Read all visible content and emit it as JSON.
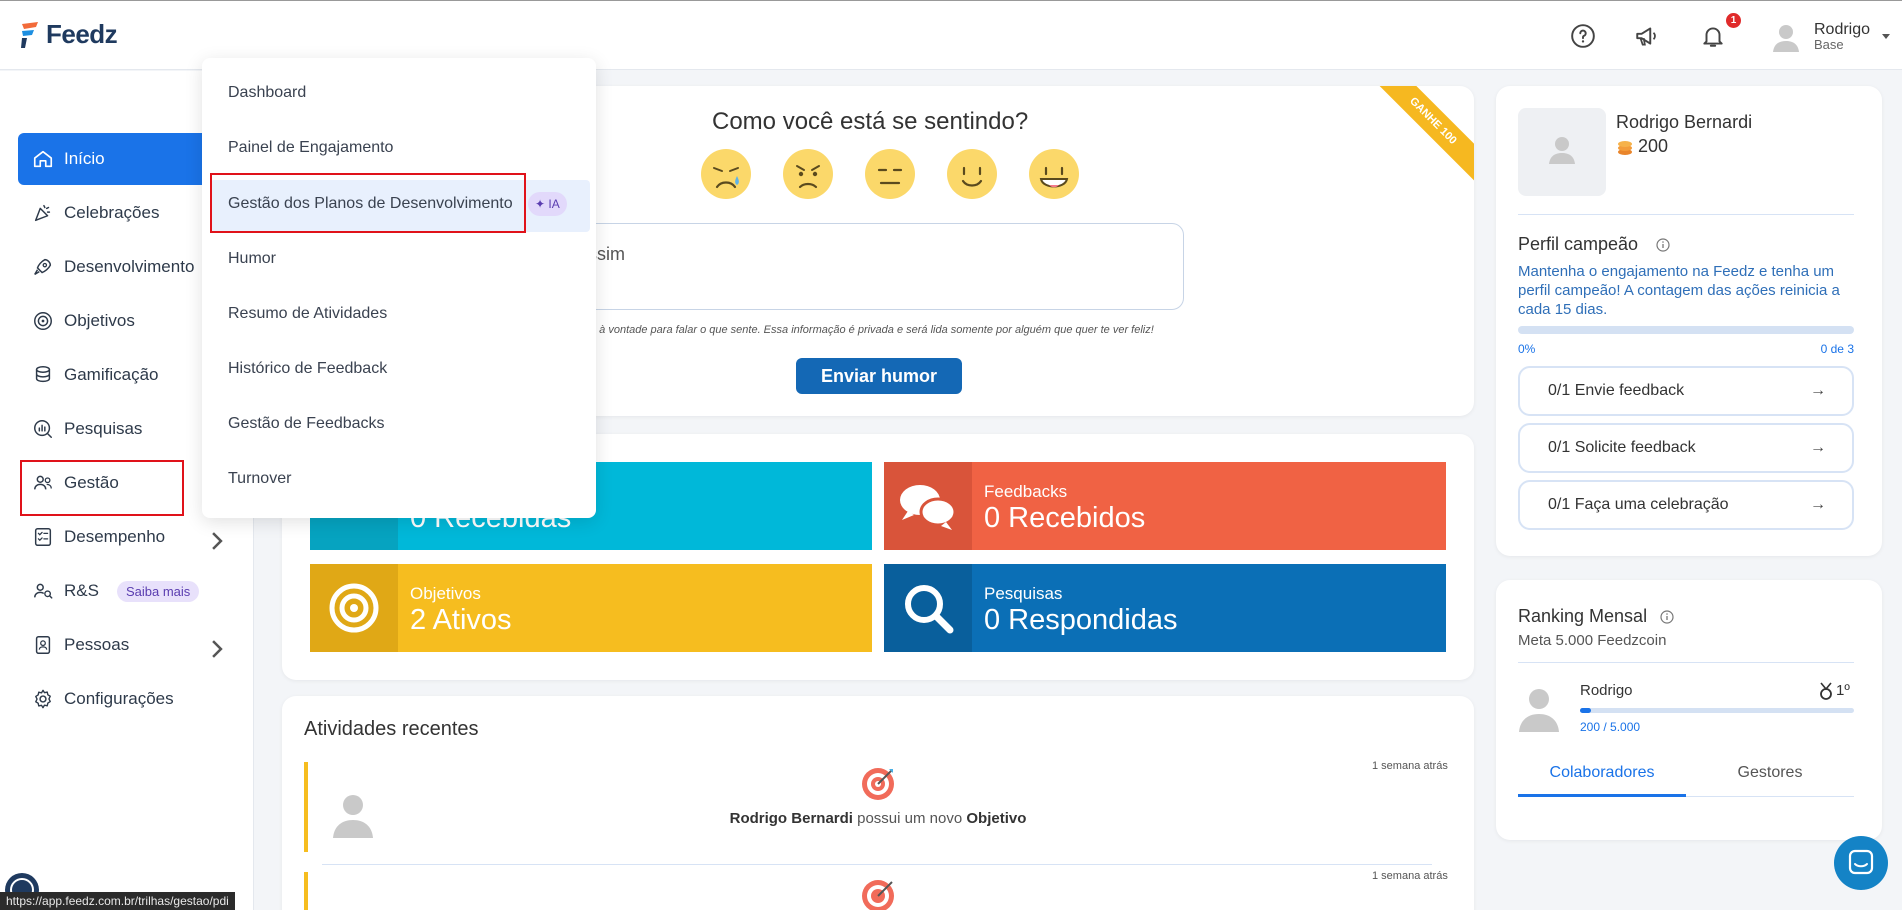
{
  "header": {
    "logo": "Feedz",
    "badge_count": "1",
    "user_name": "Rodrigo",
    "user_role": "Base"
  },
  "sidebar": {
    "items": [
      {
        "label": "Início"
      },
      {
        "label": "Celebrações"
      },
      {
        "label": "Desenvolvimento"
      },
      {
        "label": "Objetivos"
      },
      {
        "label": "Gamificação"
      },
      {
        "label": "Pesquisas"
      },
      {
        "label": "Gestão"
      },
      {
        "label": "Desempenho"
      },
      {
        "label": "R&S",
        "pill": "Saiba mais"
      },
      {
        "label": "Pessoas"
      },
      {
        "label": "Configurações"
      }
    ]
  },
  "dropdown": {
    "items": [
      {
        "label": "Dashboard"
      },
      {
        "label": "Painel de Engajamento"
      },
      {
        "label": "Gestão dos Planos de Desenvolvimento",
        "tag": "IA"
      },
      {
        "label": "Humor"
      },
      {
        "label": "Resumo de Atividades"
      },
      {
        "label": "Histórico de Feedback"
      },
      {
        "label": "Gestão de Feedbacks"
      },
      {
        "label": "Turnover"
      }
    ]
  },
  "mood": {
    "title": "Como você está se sentindo?",
    "ribbon": "GANHE 100",
    "input_placeholder": "e faz sentir assim",
    "note": "e à vontade para falar o que sente. Essa informação é privada e será lida somente por alguém que quer te ver feliz!",
    "send_label": "Enviar humor"
  },
  "stats": {
    "tile1_value": "0 Recebidas",
    "feedbacks_label": "Feedbacks",
    "feedbacks_value": "0 Recebidos",
    "objetivos_label": "Objetivos",
    "objetivos_value": "2 Ativos",
    "pesquisas_label": "Pesquisas",
    "pesquisas_value": "0 Respondidas",
    "colors": {
      "cyan": "#00b8d9",
      "orange": "#f06244",
      "yellow": "#f6bd1f",
      "blue": "#0b6fb6"
    }
  },
  "activities": {
    "title": "Atividades recentes",
    "items": [
      {
        "time": "1 semana atrás",
        "actor": "Rodrigo Bernardi",
        "verb": "possui um novo",
        "object": "Objetivo"
      },
      {
        "time": "1 semana atrás"
      }
    ]
  },
  "profile": {
    "name": "Rodrigo Bernardi",
    "coins": "200",
    "section_title": "Perfil campeão",
    "description": "Mantenha o engajamento na Feedz e tenha um perfil campeão! A contagem das ações reinicia a cada 15 dias.",
    "progress_pct": "0%",
    "progress_count": "0 de 3",
    "progress_fraction": 0,
    "challenges": [
      {
        "label": "0/1 Envie feedback"
      },
      {
        "label": "0/1 Solicite feedback"
      },
      {
        "label": "0/1 Faça uma celebração"
      }
    ]
  },
  "ranking": {
    "title": "Ranking Mensal",
    "goal": "Meta 5.000 Feedzcoin",
    "user": "Rodrigo",
    "position": "1º",
    "progress": "200 / 5.000",
    "progress_fraction": 0.04,
    "tabs": [
      {
        "label": "Colaboradores"
      },
      {
        "label": "Gestores"
      }
    ]
  },
  "status_url": "https://app.feedz.com.br/trilhas/gestao/pdi"
}
